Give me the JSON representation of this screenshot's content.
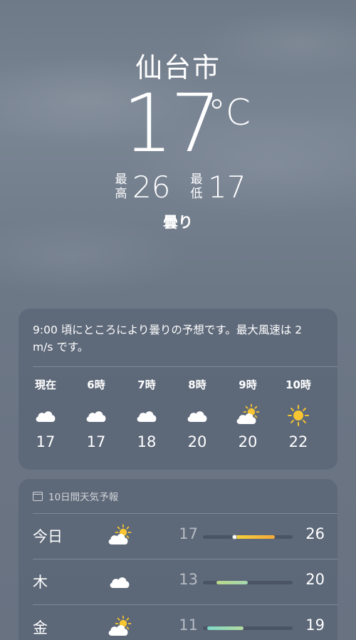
{
  "current": {
    "city": "仙台市",
    "temperature": "17",
    "unit": "°C",
    "high_label": "最高",
    "high": "26",
    "low_label": "最低",
    "low": "17",
    "condition": "曇り"
  },
  "hourly": {
    "summary": "9:00 頃にところにより曇りの予想です。最大風速は 2 m/s です。",
    "hours": [
      {
        "label": "現在",
        "icon": "cloud-icon",
        "temp": "17"
      },
      {
        "label": "6時",
        "icon": "cloud-icon",
        "temp": "17"
      },
      {
        "label": "7時",
        "icon": "cloud-icon",
        "temp": "18"
      },
      {
        "label": "8時",
        "icon": "cloud-icon",
        "temp": "20"
      },
      {
        "label": "9時",
        "icon": "partly-sunny-icon",
        "temp": "20"
      },
      {
        "label": "10時",
        "icon": "sun-icon",
        "temp": "22"
      }
    ]
  },
  "forecast": {
    "header": "10日間天気予報",
    "range_min": 10,
    "range_max": 30,
    "days": [
      {
        "day": "今日",
        "icon": "partly-sunny-icon",
        "low": "17",
        "high": "26",
        "current": 17,
        "colors": [
          "#f5d33b",
          "#f3a93a"
        ]
      },
      {
        "day": "木",
        "icon": "cloud-icon",
        "low": "13",
        "high": "20",
        "colors": [
          "#b7d88a",
          "#a6d7b0"
        ]
      },
      {
        "day": "金",
        "icon": "partly-sunny-icon",
        "low": "11",
        "high": "19",
        "colors": [
          "#7fd9c8",
          "#b3dca0"
        ]
      }
    ]
  },
  "colors": {
    "sun": "#f7c531",
    "cloud": "#ffffff",
    "card_bg": "rgba(86,97,114,0.62)"
  }
}
